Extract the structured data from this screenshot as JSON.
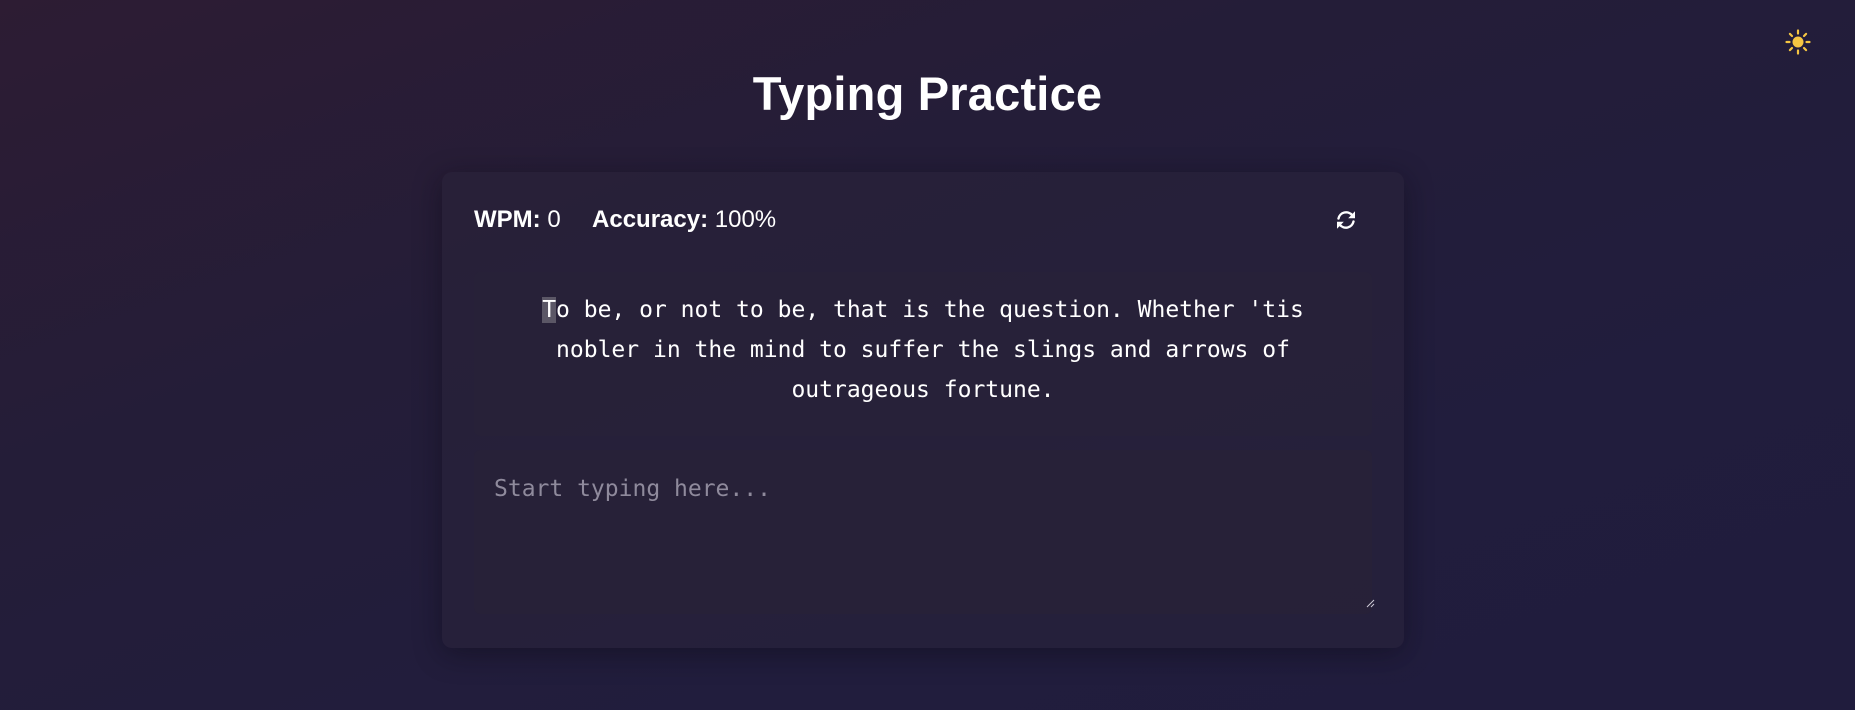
{
  "header": {
    "title": "Typing Practice",
    "theme_toggle_icon": "sun-icon"
  },
  "stats": {
    "wpm_label": "WPM:",
    "wpm_value": "0",
    "accuracy_label": "Accuracy:",
    "accuracy_value": "100%",
    "reset_icon": "refresh-icon"
  },
  "quote": {
    "current_char": "T",
    "remaining_text": "o be, or not to be, that is the question. Whether 'tis nobler in the mind to suffer the slings and arrows of outrageous fortune."
  },
  "input": {
    "value": "",
    "placeholder": "Start typing here..."
  },
  "colors": {
    "accent_sun": "#f5c542",
    "text": "#ffffff",
    "placeholder": "#8f8a9c",
    "cursor_highlight": "#5b5766"
  }
}
